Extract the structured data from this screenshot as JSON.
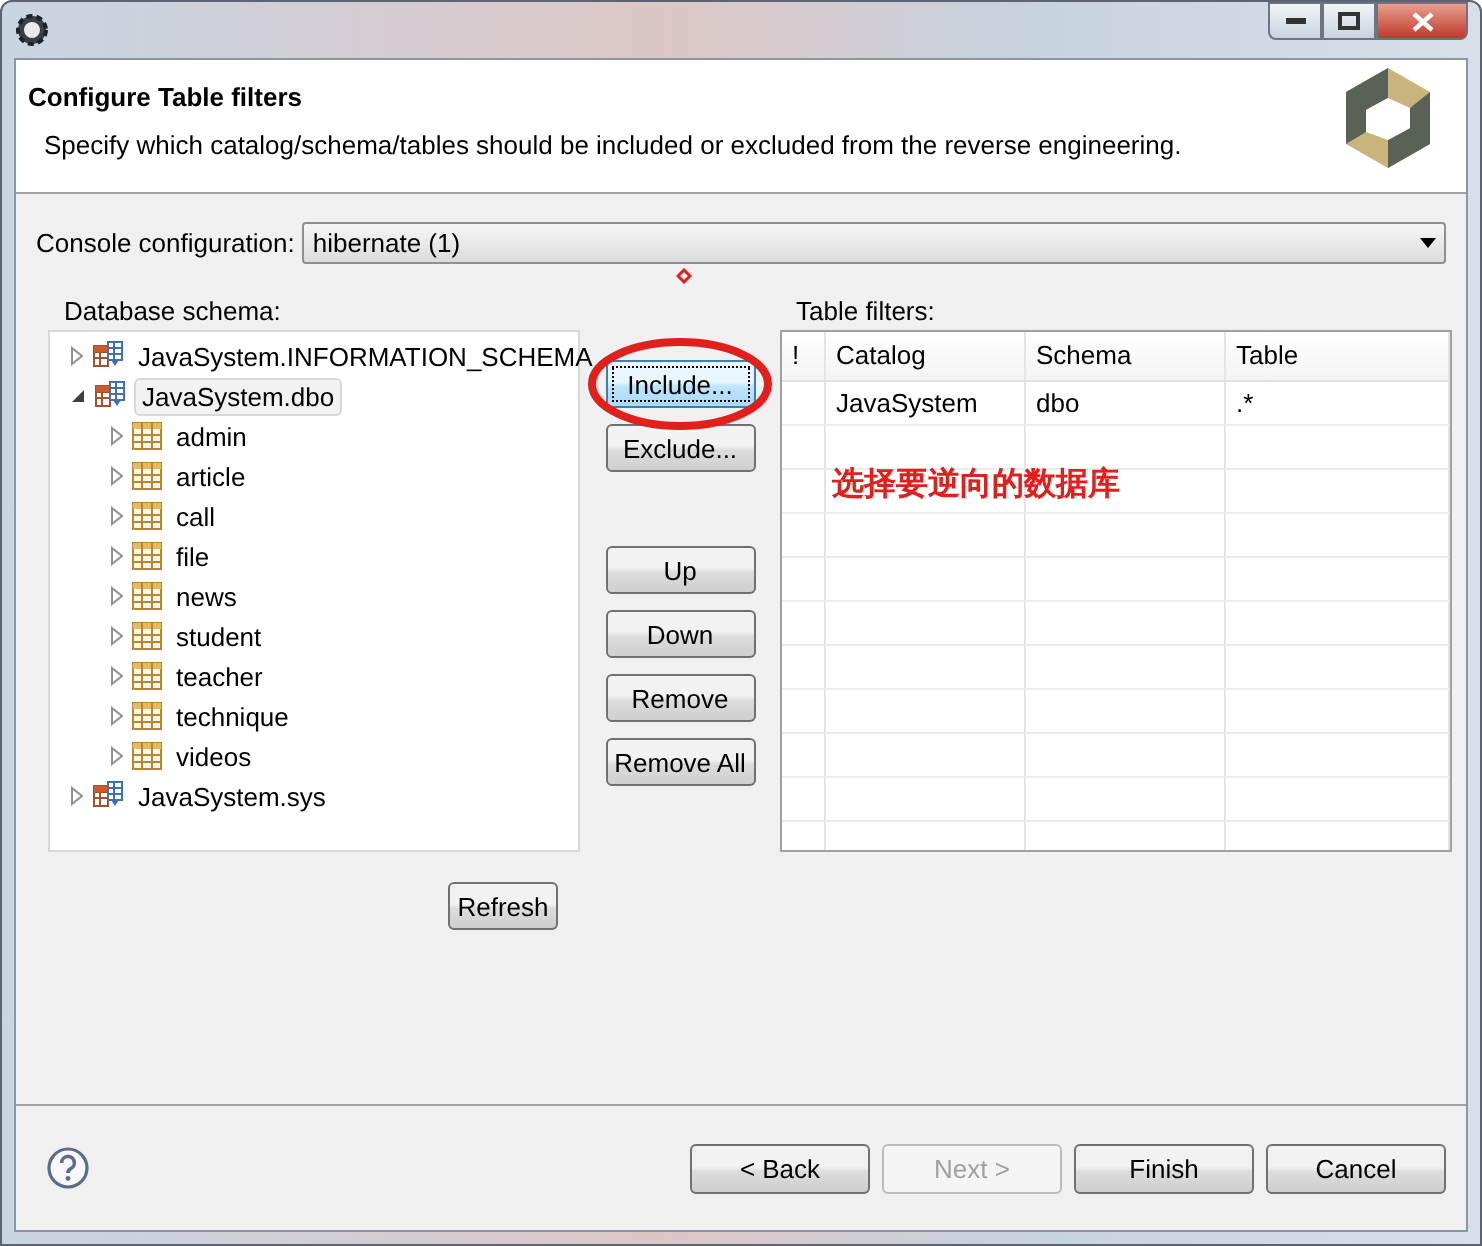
{
  "header": {
    "title": "Configure Table filters",
    "description": "Specify which catalog/schema/tables should be included or excluded from the reverse engineering."
  },
  "console_configuration": {
    "label": "Console configuration:",
    "value": "hibernate (1)"
  },
  "schema_tree": {
    "label": "Database schema:",
    "nodes": [
      {
        "label": "JavaSystem.INFORMATION_SCHEMA",
        "kind": "schema",
        "expanded": false,
        "selected": false
      },
      {
        "label": "JavaSystem.dbo",
        "kind": "schema",
        "expanded": true,
        "selected": true,
        "children": [
          {
            "label": "admin",
            "kind": "table",
            "expanded": false,
            "selected": false
          },
          {
            "label": "article",
            "kind": "table",
            "expanded": false,
            "selected": false
          },
          {
            "label": "call",
            "kind": "table",
            "expanded": false,
            "selected": false
          },
          {
            "label": "file",
            "kind": "table",
            "expanded": false,
            "selected": false
          },
          {
            "label": "news",
            "kind": "table",
            "expanded": false,
            "selected": false
          },
          {
            "label": "student",
            "kind": "table",
            "expanded": false,
            "selected": false
          },
          {
            "label": "teacher",
            "kind": "table",
            "expanded": false,
            "selected": false
          },
          {
            "label": "technique",
            "kind": "table",
            "expanded": false,
            "selected": false
          },
          {
            "label": "videos",
            "kind": "table",
            "expanded": false,
            "selected": false
          }
        ]
      },
      {
        "label": "JavaSystem.sys",
        "kind": "schema",
        "expanded": false,
        "selected": false
      }
    ]
  },
  "filter_button_groups": [
    {
      "buttons": [
        {
          "label": "Include...",
          "focused": true
        },
        {
          "label": "Exclude...",
          "focused": false
        }
      ]
    },
    {
      "buttons": [
        {
          "label": "Up",
          "focused": false
        },
        {
          "label": "Down",
          "focused": false
        },
        {
          "label": "Remove",
          "focused": false
        },
        {
          "label": "Remove All",
          "focused": false
        }
      ]
    }
  ],
  "refresh_button": {
    "label": "Refresh"
  },
  "table_filters": {
    "label": "Table filters:",
    "columns": [
      "!",
      "Catalog",
      "Schema",
      "Table"
    ],
    "rows": [
      {
        "catalog": "JavaSystem",
        "schema": "dbo",
        "table": ".*"
      }
    ]
  },
  "annotation": {
    "text": "选择要逆向的数据库"
  },
  "nav_buttons": [
    {
      "label": "< Back",
      "disabled": false
    },
    {
      "label": "Next >",
      "disabled": true
    },
    {
      "label": "Finish",
      "disabled": false
    },
    {
      "label": "Cancel",
      "disabled": false
    }
  ]
}
